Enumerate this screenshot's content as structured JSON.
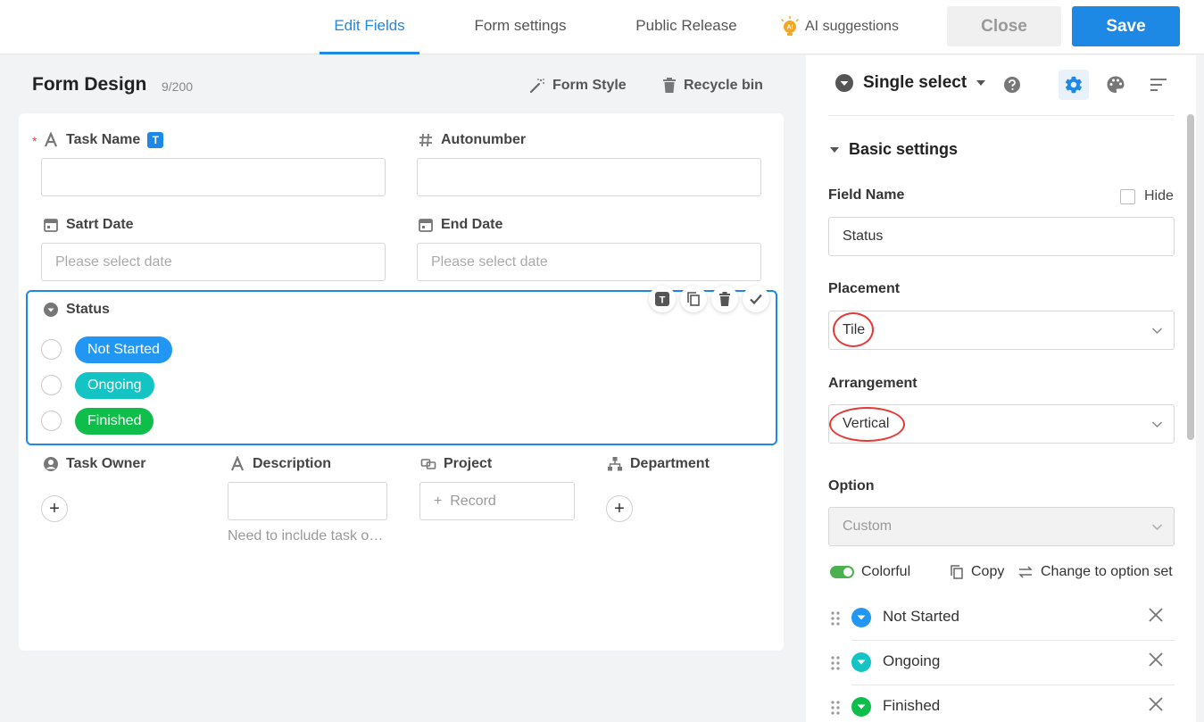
{
  "tabs": [
    {
      "label": "Edit Fields",
      "active": true
    },
    {
      "label": "Form settings",
      "active": false
    },
    {
      "label": "Public Release",
      "active": false
    }
  ],
  "ai_suggestions": "AI suggestions",
  "ai_badge": "AI",
  "buttons": {
    "close": "Close",
    "save": "Save"
  },
  "form": {
    "title": "Form Design",
    "count": "9/200",
    "form_style": "Form Style",
    "recycle_bin": "Recycle bin"
  },
  "fields": {
    "task_name": {
      "label": "Task Name",
      "badge": "T",
      "required": "*"
    },
    "autonumber": {
      "label": "Autonumber"
    },
    "start_date": {
      "label": "Satrt Date",
      "placeholder": "Please select date"
    },
    "end_date": {
      "label": "End Date",
      "placeholder": "Please select date"
    },
    "status": {
      "label": "Status",
      "mini_tool_badge": "T",
      "options": [
        {
          "label": "Not Started",
          "color": "#2196f3"
        },
        {
          "label": "Ongoing",
          "color": "#14c4c4"
        },
        {
          "label": "Finished",
          "color": "#0fbe4a"
        }
      ]
    },
    "task_owner": {
      "label": "Task Owner",
      "add": "+"
    },
    "description": {
      "label": "Description",
      "helper": "Need to include task objectives"
    },
    "project": {
      "label": "Project",
      "record": "Record",
      "record_plus": "+"
    },
    "department": {
      "label": "Department",
      "add": "+"
    }
  },
  "panel": {
    "field_type": "Single select",
    "basic_settings": "Basic settings",
    "field_name_label": "Field Name",
    "hide_label": "Hide",
    "field_name_value": "Status",
    "placement_label": "Placement",
    "placement_value": "Tile",
    "arrangement_label": "Arrangement",
    "arrangement_value": "Vertical",
    "option_label": "Option",
    "option_source": "Custom",
    "colorful": "Colorful",
    "copy": "Copy",
    "change_option_set": "Change to option set",
    "options": [
      {
        "label": "Not Started",
        "color": "#2196f3"
      },
      {
        "label": "Ongoing",
        "color": "#14c4c4"
      },
      {
        "label": "Finished",
        "color": "#0fbe4a"
      }
    ]
  },
  "colors": {
    "accent": "#1e88e5",
    "required": "#e53935",
    "annotation": "#e53935"
  }
}
